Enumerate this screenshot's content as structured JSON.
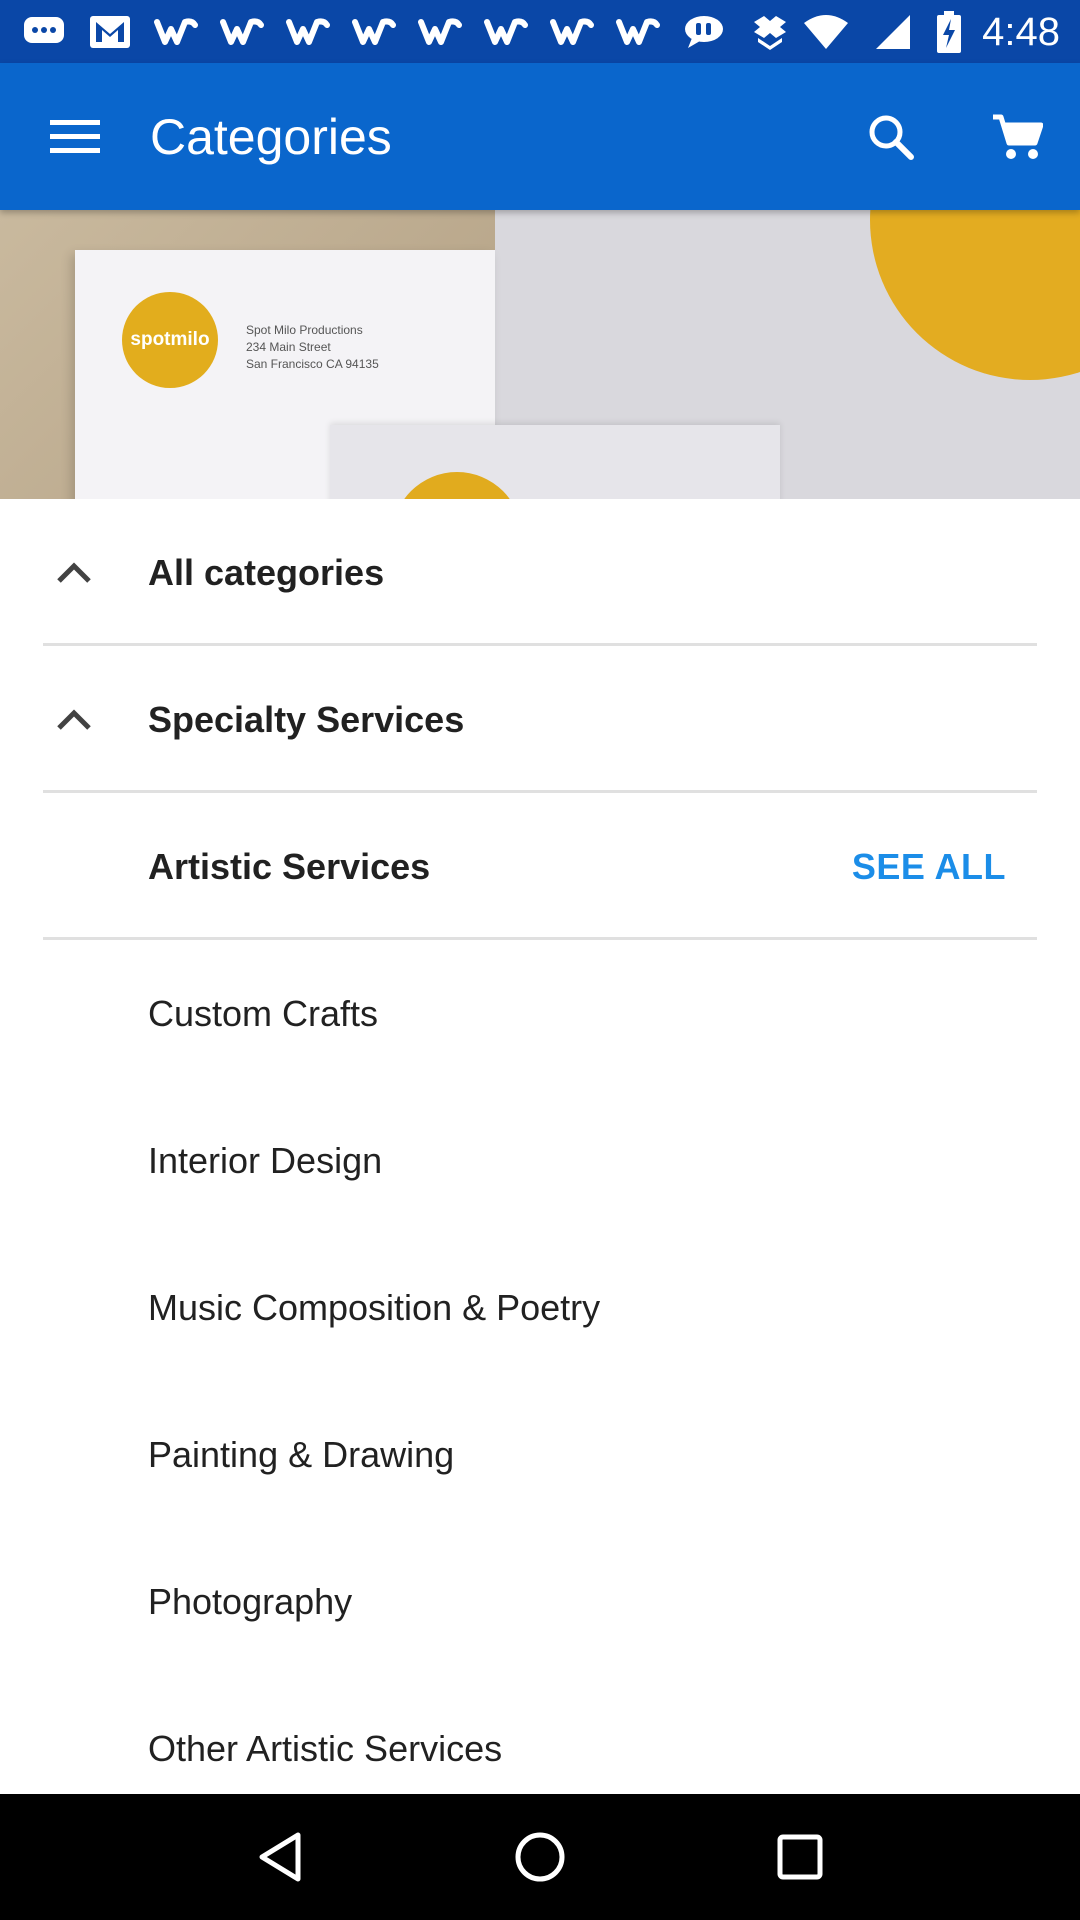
{
  "status_bar": {
    "time": "4:48",
    "notification_icons": [
      "messages-icon",
      "gmail-icon",
      "walmart-w-icon",
      "walmart-w-icon",
      "walmart-w-icon",
      "walmart-w-icon",
      "walmart-w-icon",
      "walmart-w-icon",
      "walmart-w-icon",
      "walmart-w-icon",
      "chat-bubble-icon",
      "dropbox-icon"
    ],
    "system_icons": [
      "wifi-icon",
      "cell-signal-icon",
      "battery-charging-icon"
    ]
  },
  "app_bar": {
    "title": "Categories",
    "menu_icon": "hamburger-menu-icon",
    "actions": [
      "search-icon",
      "cart-icon"
    ],
    "background": "#0a66cc"
  },
  "banner": {
    "logo_text": "spotmilo",
    "address_lines": [
      "Spot Milo Productions",
      "234 Main Street",
      "San Francisco CA 94135"
    ],
    "accent": "#e3ac21"
  },
  "list": {
    "all_categories": "All categories",
    "specialty_services": "Specialty Services",
    "artistic_services": "Artistic Services",
    "see_all": "SEE ALL",
    "items": [
      "Custom Crafts",
      "Interior Design",
      "Music Composition & Poetry",
      "Painting & Drawing",
      "Photography",
      "Other Artistic Services"
    ],
    "link_color": "#1b8de8"
  },
  "nav_bar": {
    "buttons": [
      "back-icon",
      "home-icon",
      "recents-icon"
    ]
  }
}
